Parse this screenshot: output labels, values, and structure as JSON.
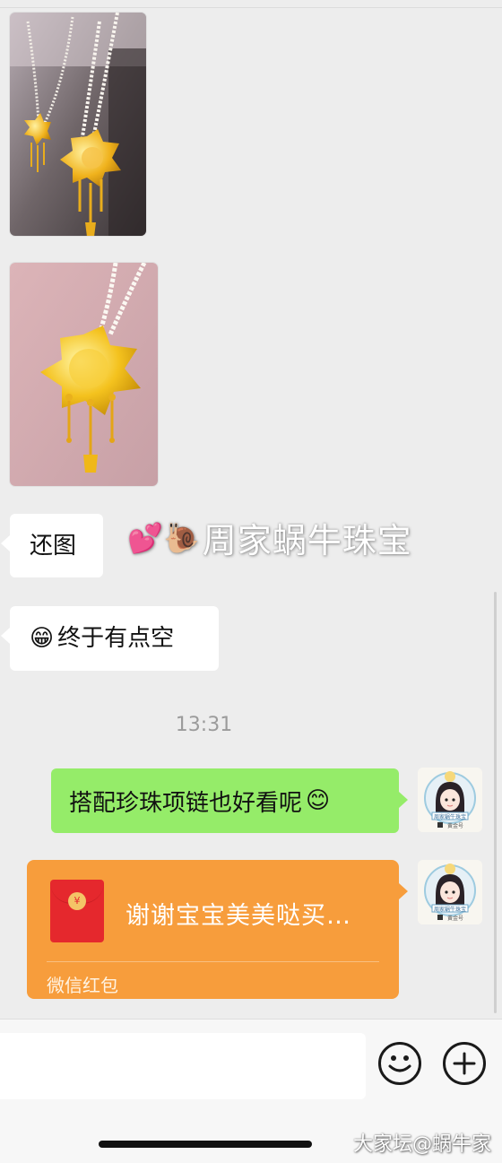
{
  "messages": {
    "image1_alt": "",
    "bubble1": "还图",
    "bubble2_emoji": "😁",
    "bubble2_text": "终于有点空",
    "timestamp": "13:31",
    "my_message_text": "搭配珍珠项链也好看呢",
    "my_message_emoji": "😊"
  },
  "watermark": {
    "emojis": "💕🐌",
    "text": "周家蜗牛珠宝"
  },
  "red_packet": {
    "title": "谢谢宝宝美美哒买…",
    "footer": "微信红包",
    "coin_symbol": "¥"
  },
  "avatar": {
    "badge_text": "周家蜗牛珠宝",
    "sub_label": "黄金号"
  },
  "corner_watermark": "大家坛@蜗牛家",
  "colors": {
    "background": "#ededed",
    "incoming_bubble": "#ffffff",
    "outgoing_bubble": "#95ec69",
    "red_packet": "#f79d3c",
    "red_packet_icon": "#e5282d"
  },
  "icons": {
    "emoji_button": "smiley-icon",
    "plus_button": "plus-icon"
  }
}
